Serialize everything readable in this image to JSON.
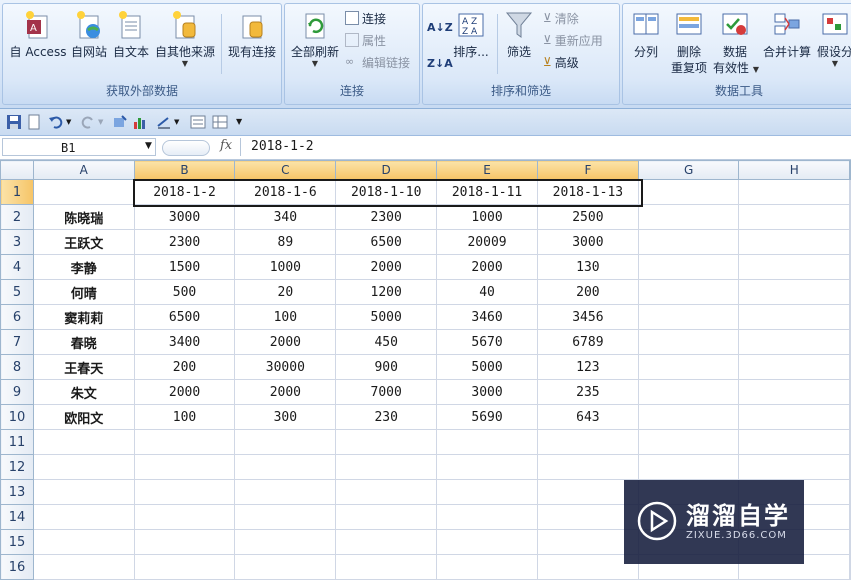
{
  "ribbon": {
    "groups": [
      {
        "label": "获取外部数据",
        "buttons": [
          "自 Access",
          "自网站",
          "自文本",
          "自其他来源",
          "现有连接"
        ]
      },
      {
        "label": "连接",
        "buttons": [
          "全部刷新"
        ],
        "small": [
          "连接",
          "属性",
          "编辑链接"
        ]
      },
      {
        "label": "排序和筛选",
        "buttons": [
          "排序...",
          "筛选"
        ],
        "small": [
          "清除",
          "重新应用",
          "高级"
        ]
      },
      {
        "label": "数据工具",
        "buttons": [
          "分列",
          "删除",
          "重复项",
          "数据",
          "有效性",
          "合并计算",
          "假设分"
        ]
      }
    ]
  },
  "formula_bar": {
    "name_box": "B1",
    "fx_symbol": "fx",
    "content": "2018-1-2"
  },
  "sheet": {
    "columns": [
      "A",
      "B",
      "C",
      "D",
      "E",
      "F",
      "G",
      "H"
    ],
    "header_row": [
      "",
      "2018-1-2",
      "2018-1-6",
      "2018-1-10",
      "2018-1-11",
      "2018-1-13"
    ],
    "rows": [
      {
        "num": "2",
        "name": "陈晓瑞",
        "values": [
          "3000",
          "340",
          "2300",
          "1000",
          "2500"
        ]
      },
      {
        "num": "3",
        "name": "王跃文",
        "values": [
          "2300",
          "89",
          "6500",
          "20009",
          "3000"
        ]
      },
      {
        "num": "4",
        "name": "李静",
        "values": [
          "1500",
          "1000",
          "2000",
          "2000",
          "130"
        ]
      },
      {
        "num": "5",
        "name": "何晴",
        "values": [
          "500",
          "20",
          "1200",
          "40",
          "200"
        ]
      },
      {
        "num": "6",
        "name": "窦莉莉",
        "values": [
          "6500",
          "100",
          "5000",
          "3460",
          "3456"
        ]
      },
      {
        "num": "7",
        "name": "春晓",
        "values": [
          "3400",
          "2000",
          "450",
          "5670",
          "6789"
        ]
      },
      {
        "num": "8",
        "name": "王春天",
        "values": [
          "200",
          "30000",
          "900",
          "5000",
          "123"
        ]
      },
      {
        "num": "9",
        "name": "朱文",
        "values": [
          "2000",
          "2000",
          "7000",
          "3000",
          "235"
        ]
      },
      {
        "num": "10",
        "name": "欧阳文",
        "values": [
          "100",
          "300",
          "230",
          "5690",
          "643"
        ]
      }
    ],
    "empty_rows": [
      "11",
      "12",
      "13",
      "14",
      "15",
      "16"
    ]
  },
  "watermark": {
    "title": "溜溜自学",
    "url": "ZIXUE.3D66.COM"
  },
  "colors": {
    "selection_header": "#f6c467",
    "grid_line": "#d0d7e5",
    "ribbon_bg": "#dbe8f8"
  }
}
